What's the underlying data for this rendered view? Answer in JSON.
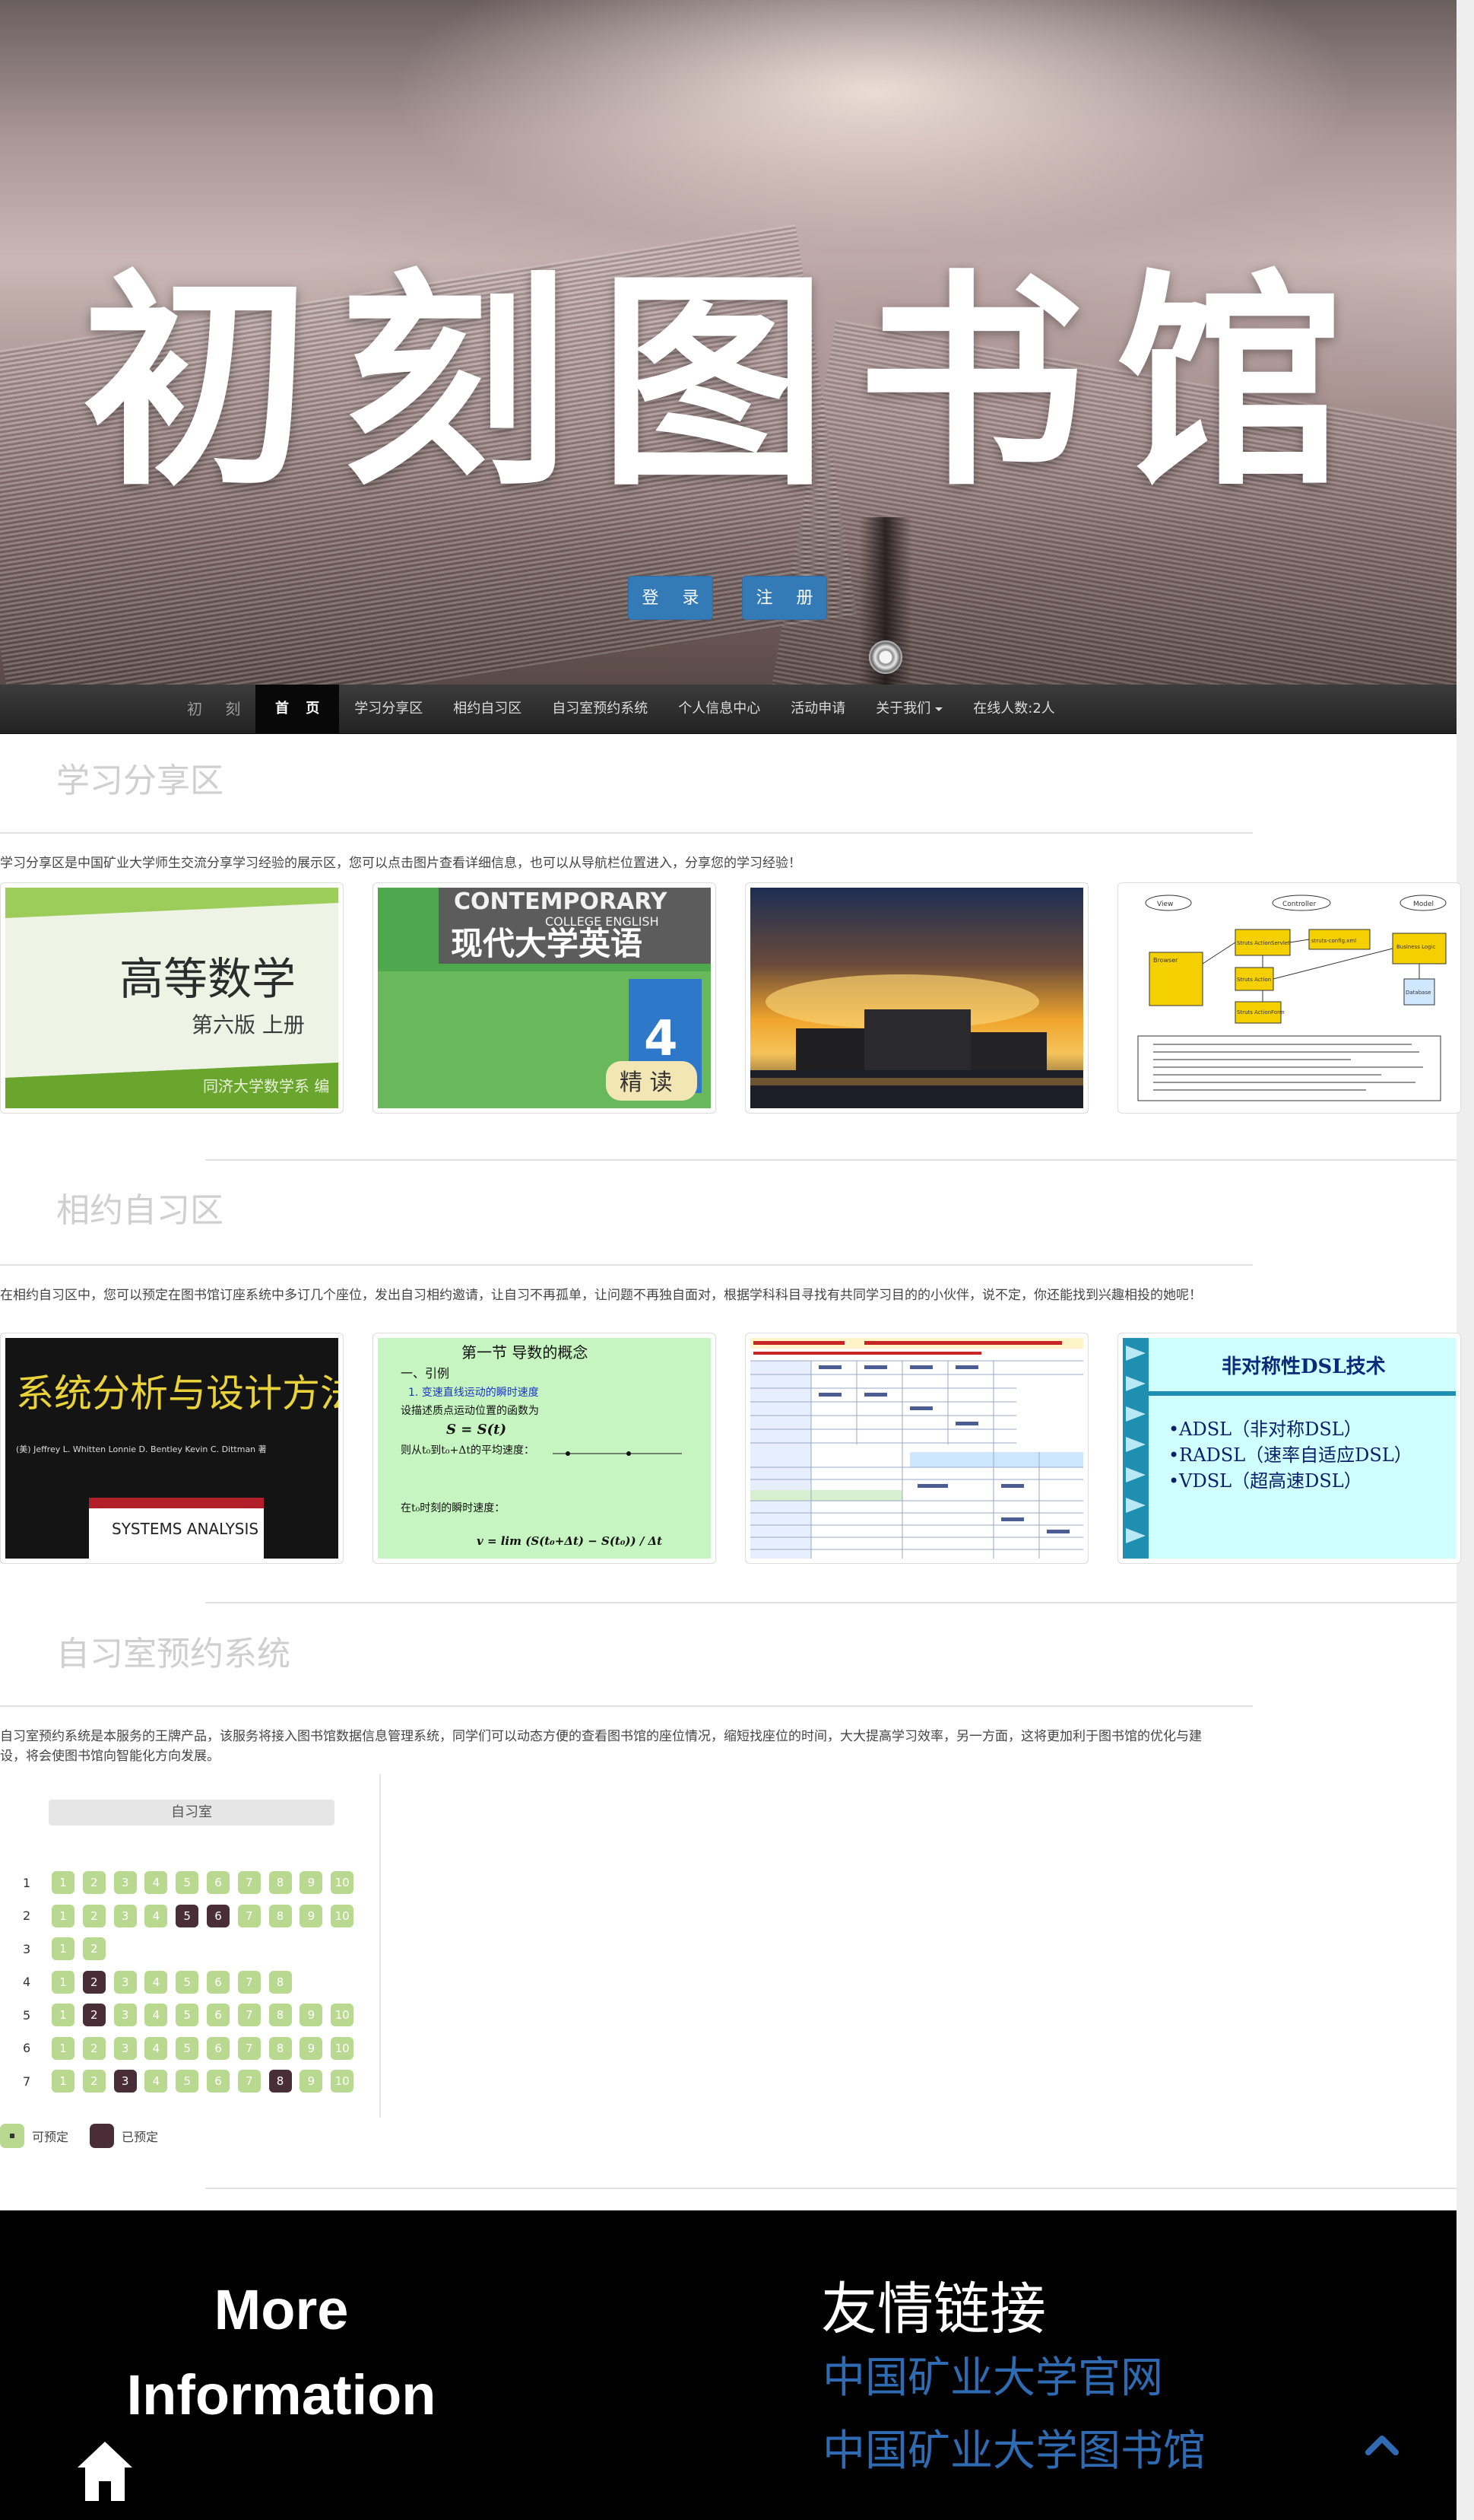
{
  "hero": {
    "title": "初刻图书馆",
    "login_label": "登 录",
    "register_label": "注 册"
  },
  "navbar": {
    "brand": "初 刻",
    "items": [
      {
        "label": "首 页",
        "active": true
      },
      {
        "label": "学习分享区"
      },
      {
        "label": "相约自习区"
      },
      {
        "label": "自习室预约系统"
      },
      {
        "label": "个人信息中心"
      },
      {
        "label": "活动申请"
      },
      {
        "label": "关于我们",
        "dropdown": true
      },
      {
        "label": "在线人数:2人"
      }
    ]
  },
  "share": {
    "title": "学习分享区",
    "desc": "学习分享区是中国矿业大学师生交流分享学习经验的展示区，您可以点击图片查看详细信息，也可以从导航栏位置进入，分享您的学习经验！",
    "cards": [
      {
        "text": "高等数学",
        "sub": "第六版 上册",
        "author": "同济大学数学系 编"
      },
      {
        "brand": "CONTEMPORARY",
        "subtitle": "COLLEGE ENGLISH",
        "text": "现代大学英语",
        "number": "4",
        "badge": "精 读"
      },
      {
        "icon": "campus-photo"
      },
      {
        "labels": [
          "View",
          "Controller",
          "Model",
          "Browser",
          "Struts ActionServlet",
          "struts-config.xml",
          "Business Logic",
          "Database",
          "Struts Action",
          "Struts ActionForm"
        ]
      }
    ]
  },
  "study": {
    "title": "相约自习区",
    "desc": "在相约自习区中，您可以预定在图书馆订座系统中多订几个座位，发出自习相约邀请，让自习不再孤单，让问题不再独自面对，根据学科科目寻找有共同学习目的的小伙伴，说不定，你还能找到兴趣相投的她呢！",
    "cards": [
      {
        "text": "系统分析与设计方法",
        "authors": "(美) Jeffrey L. Whitten  Lonnie D. Bentley  Kevin C. Dittman 著",
        "english": "SYSTEMS ANALYSIS"
      },
      {
        "title": "第一节  导数的概念",
        "line1": "一、引例",
        "line2": "1.  变速直线运动的瞬时速度",
        "line3": "设描述质点运动位置的函数为",
        "eq1": "S = S(t)",
        "line4": "则从t₀到t₀+Δt的平均速度：",
        "line5": "在t₀时刻的瞬时速度：",
        "eq2": "v = lim (S(t₀+Δt) − S(t₀)) / Δt"
      },
      {
        "caption": "spreadsheet-slide"
      },
      {
        "title": "非对称性DSL技术",
        "items": [
          "•ADSL（非对称DSL）",
          "•RADSL（速率自适应DSL）",
          "•VDSL（超高速DSL）"
        ]
      }
    ]
  },
  "booking": {
    "title": "自习室预约系统",
    "desc": "自习室预约系统是本服务的王牌产品，该服务将接入图书馆数据信息管理系统，同学们可以动态方便的查看图书馆的座位情况，缩短找座位的时间，大大提高学习效率，另一方面，这将更加利于图书馆的优化与建设，将会使图书馆向智能化方向发展。",
    "room_label": "自习室",
    "rows": [
      {
        "num": "1",
        "seats": [
          [
            "1",
            "free"
          ],
          [
            "2",
            "free"
          ],
          [
            "3",
            "free"
          ],
          [
            "4",
            "free"
          ],
          [
            "5",
            "free"
          ],
          [
            "6",
            "free"
          ],
          [
            "7",
            "free"
          ],
          [
            "8",
            "free"
          ],
          [
            "9",
            "free"
          ],
          [
            "10",
            "free"
          ]
        ]
      },
      {
        "num": "2",
        "seats": [
          [
            "1",
            "free"
          ],
          [
            "2",
            "free"
          ],
          [
            "3",
            "free"
          ],
          [
            "4",
            "free"
          ],
          [
            "5",
            "taken"
          ],
          [
            "6",
            "taken"
          ],
          [
            "7",
            "free"
          ],
          [
            "8",
            "free"
          ],
          [
            "9",
            "free"
          ],
          [
            "10",
            "free"
          ]
        ]
      },
      {
        "num": "3",
        "seats": [
          [
            "1",
            "free"
          ],
          [
            "2",
            "free"
          ]
        ]
      },
      {
        "num": "4",
        "seats": [
          [
            "1",
            "free"
          ],
          [
            "2",
            "taken"
          ],
          [
            "3",
            "free"
          ],
          [
            "4",
            "free"
          ],
          [
            "5",
            "free"
          ],
          [
            "6",
            "free"
          ],
          [
            "7",
            "free"
          ],
          [
            "8",
            "free"
          ]
        ]
      },
      {
        "num": "5",
        "seats": [
          [
            "1",
            "free"
          ],
          [
            "2",
            "taken"
          ],
          [
            "3",
            "free"
          ],
          [
            "4",
            "free"
          ],
          [
            "5",
            "free"
          ],
          [
            "6",
            "free"
          ],
          [
            "7",
            "free"
          ],
          [
            "8",
            "free"
          ],
          [
            "9",
            "free"
          ],
          [
            "10",
            "free"
          ]
        ]
      },
      {
        "num": "6",
        "seats": [
          [
            "1",
            "free"
          ],
          [
            "2",
            "free"
          ],
          [
            "3",
            "free"
          ],
          [
            "4",
            "free"
          ],
          [
            "5",
            "free"
          ],
          [
            "6",
            "free"
          ],
          [
            "7",
            "free"
          ],
          [
            "8",
            "free"
          ],
          [
            "9",
            "free"
          ],
          [
            "10",
            "free"
          ]
        ]
      },
      {
        "num": "7",
        "seats": [
          [
            "1",
            "free"
          ],
          [
            "2",
            "free"
          ],
          [
            "3",
            "taken"
          ],
          [
            "4",
            "free"
          ],
          [
            "5",
            "free"
          ],
          [
            "6",
            "free"
          ],
          [
            "7",
            "free"
          ],
          [
            "8",
            "taken"
          ],
          [
            "9",
            "free"
          ],
          [
            "10",
            "free"
          ]
        ]
      }
    ],
    "legend_free": "可预定",
    "legend_taken": "已预定",
    "colors": {
      "free": "#b9d990",
      "taken": "#4a2e37"
    }
  },
  "footer": {
    "more_line1": "More",
    "more_line2": "Information",
    "links_title": "友情链接",
    "links": [
      "中国矿业大学官网",
      "中国矿业大学图书馆"
    ],
    "home_icon": "home-icon",
    "top_icon": "chevron-up-icon",
    "link_color": "#2f6bb3"
  }
}
